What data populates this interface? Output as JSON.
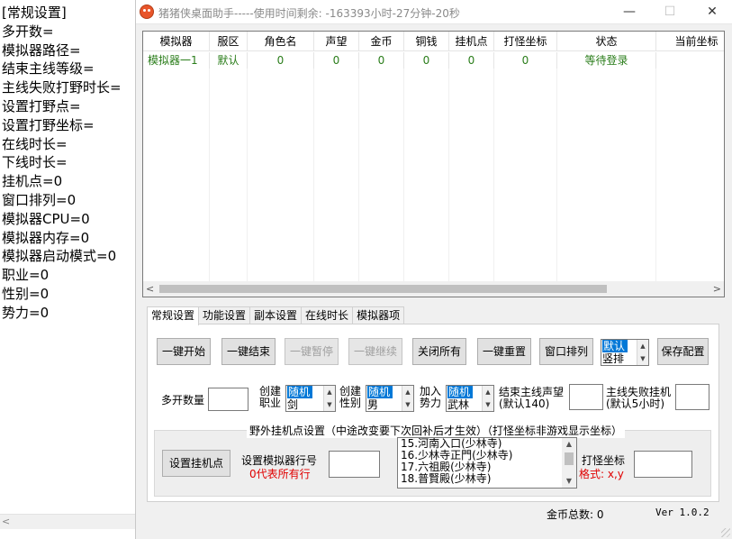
{
  "editor": {
    "lines": [
      "[常规设置]",
      "多开数=",
      "模拟器路径=",
      "结束主线等级=",
      "主线失败打野时长=",
      "设置打野点=",
      "设置打野坐标=",
      "在线时长=",
      "下线时长=",
      "挂机点=0",
      "窗口排列=0",
      "模拟器CPU=0",
      "模拟器内存=0",
      "模拟器启动模式=0",
      "职业=0",
      "性别=0",
      "势力=0"
    ],
    "scroll_left_icon": "chevron-left-icon"
  },
  "window": {
    "title": "猪猪侠桌面助手-----使用时间剩余:  -163393小时-27分钟-20秒",
    "minimize": "—",
    "maximize": "☐",
    "close": "✕"
  },
  "list": {
    "columns": [
      "模拟器",
      "服区",
      "角色名",
      "声望",
      "金币",
      "铜钱",
      "挂机点",
      "打怪坐标",
      "状态",
      "当前坐标"
    ],
    "rows": [
      [
        "模拟器一1",
        "默认",
        "0",
        "0",
        "0",
        "0",
        "0",
        "0",
        "等待登录",
        ""
      ]
    ],
    "row_color": "#2a7d1a"
  },
  "tabs": [
    "常规设置",
    "功能设置",
    "副本设置",
    "在线时长",
    "模拟器项"
  ],
  "active_tab": "常规设置",
  "buttons": {
    "start_all": "一键开始",
    "end_all": "一键结束",
    "pause_all": "一键暂停",
    "resume_all": "一键继续",
    "close_all": "关闭所有",
    "reset_all": "一键重置",
    "arrange": "窗口排列",
    "save": "保存配置",
    "set_spot": "设置挂机点"
  },
  "arrange_options": {
    "selected": "默认",
    "next": "竖排"
  },
  "form": {
    "multi_open_label": "多开数量",
    "create_job_label": "创建\n职业",
    "job_options": {
      "selected": "随机",
      "next": "剑"
    },
    "create_gender_label": "创建\n性别",
    "gender_options": {
      "selected": "随机",
      "next": "男"
    },
    "join_faction_label": "加入\n势力",
    "faction_options": {
      "selected": "随机",
      "next": "武林"
    },
    "end_main_label": "结束主线声望\n(默认140)",
    "main_fail_label": "主线失败挂机\n(默认5小时)"
  },
  "group": {
    "title": "野外挂机点设置（中途改变要下次回补后才生效）（打怪坐标非游戏显示坐标）",
    "row_label": "设置模拟器行号",
    "row_hint": "0代表所有行",
    "spots": [
      "15.河南入口(少林寺)",
      "16.少林寺正門(少林寺)",
      "17.六祖殿(少林寺)",
      "18.普賢殿(少林寺)"
    ],
    "coord_label": "打怪坐标",
    "coord_hint": "格式: x,y"
  },
  "status": {
    "gold_total": "金币总数: 0",
    "version": "Ver 1.0.2"
  },
  "colors": {
    "disabled_text": "#a0a0a0",
    "hint_red": "#e00000",
    "selection_blue": "#0078d7"
  }
}
